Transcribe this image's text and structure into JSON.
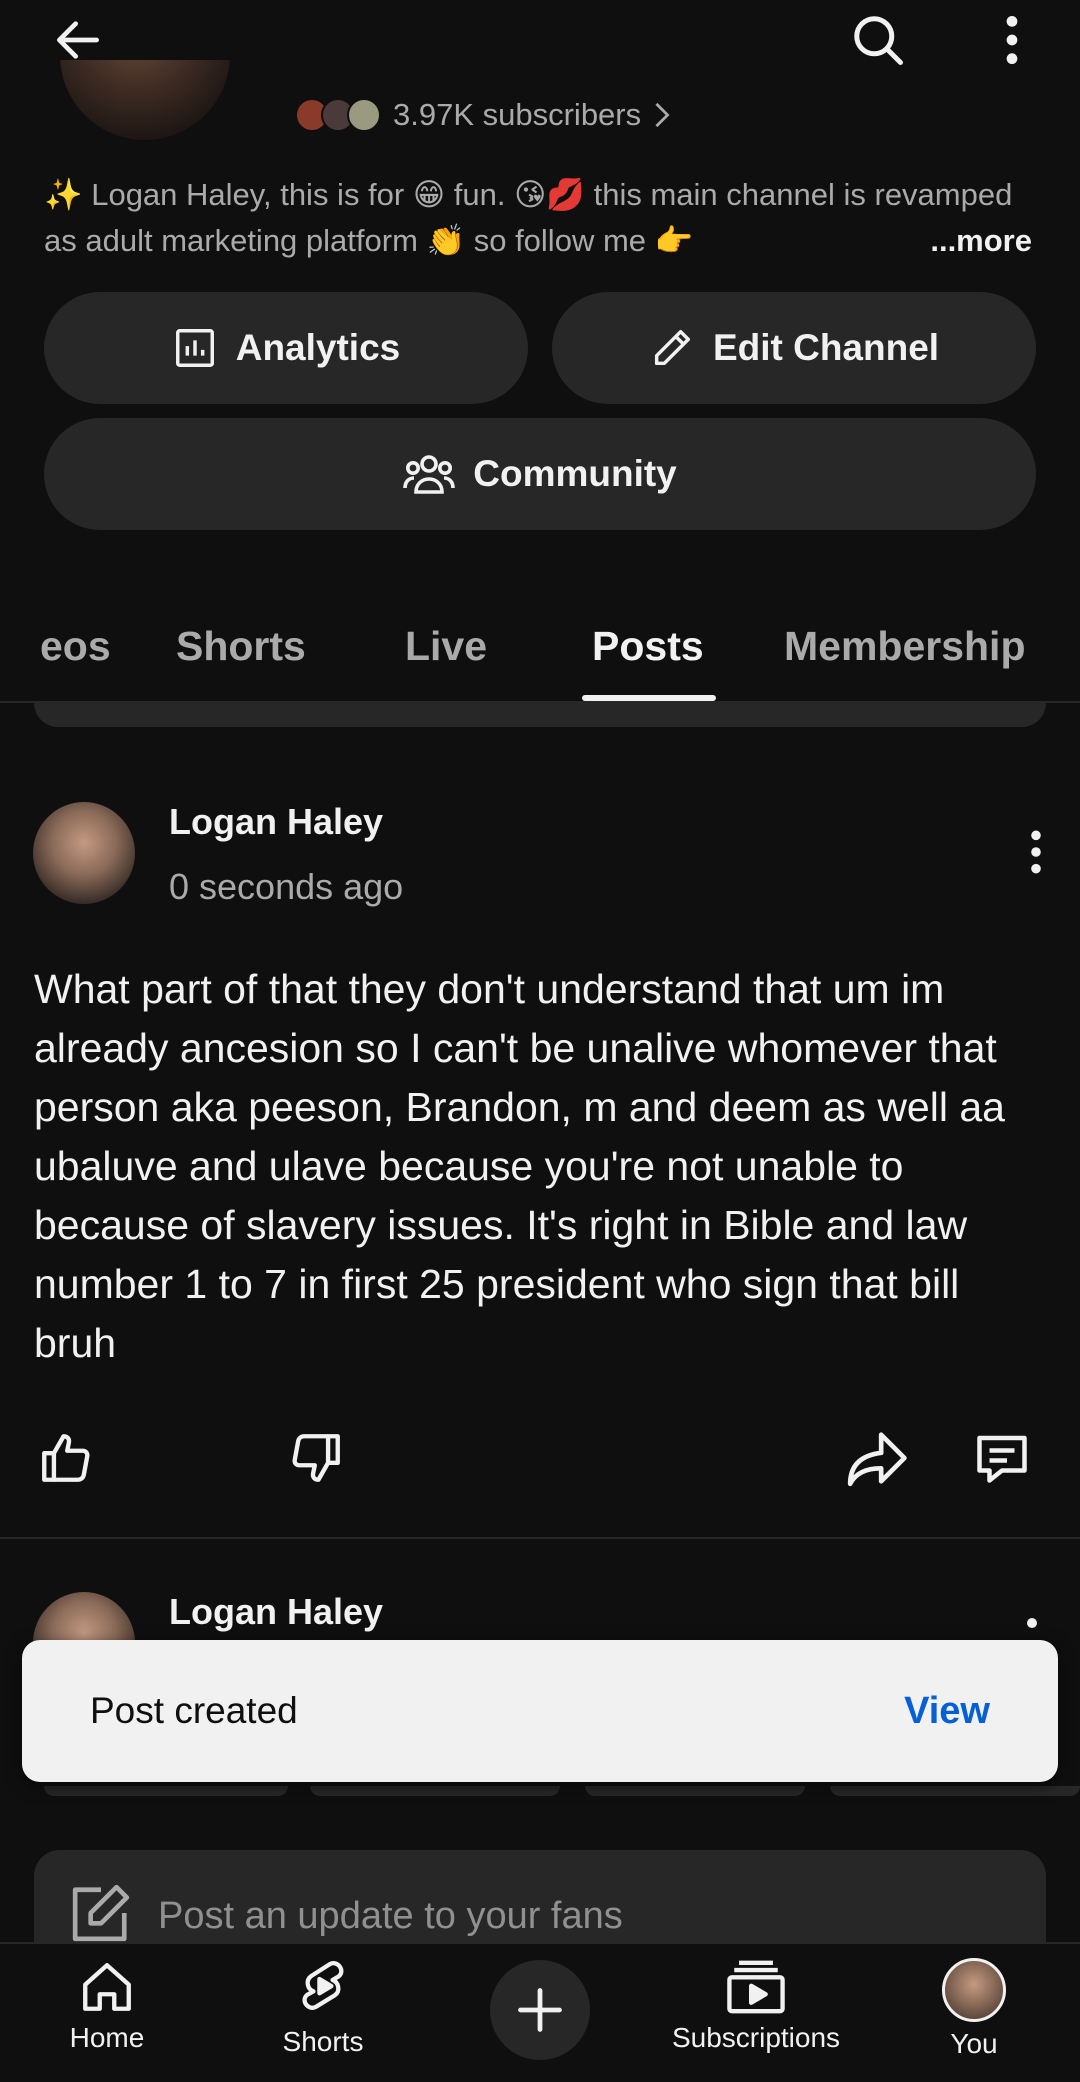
{
  "channel": {
    "subscribers": "3.97K subscribers",
    "description": "✨ Logan Haley, this is for 😁 fun. 😘💋 this main channel is revamped as adult marketing platform 👏 so follow me 👉",
    "more_label": "...more"
  },
  "actions": {
    "analytics": "Analytics",
    "edit_channel": "Edit Channel",
    "community": "Community"
  },
  "tabs": [
    {
      "label": "eos",
      "active": false
    },
    {
      "label": "Shorts",
      "active": false
    },
    {
      "label": "Live",
      "active": false
    },
    {
      "label": "Posts",
      "active": true
    },
    {
      "label": "Membership",
      "active": false
    }
  ],
  "posts": [
    {
      "author": "Logan Haley",
      "time": "0 seconds ago",
      "text": "What part of that they don't understand that um im already ancesion so I can't be unalive whomever that person aka peeson,  Brandon,  m and deem as well aa ubaluve and ulave because you're not unable to because of slavery issues. It's right in Bible and law number 1 to 7 in first 25 president who sign that bill bruh"
    },
    {
      "author": "Logan Haley"
    }
  ],
  "toast": {
    "message": "Post created",
    "action": "View"
  },
  "composer": {
    "placeholder": "Post an update to your fans"
  },
  "bottom_nav": {
    "home": "Home",
    "shorts": "Shorts",
    "subscriptions": "Subscriptions",
    "you": "You"
  },
  "colors": {
    "background": "#0f0f0f",
    "surface": "#272727",
    "link": "#065fd4"
  }
}
